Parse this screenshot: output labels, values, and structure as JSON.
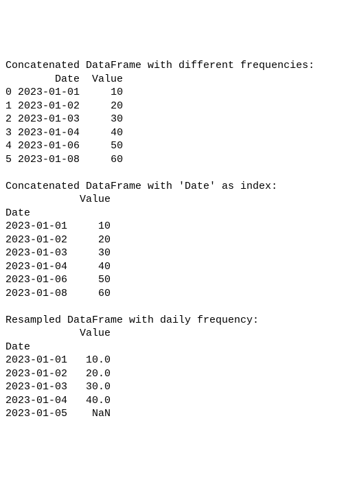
{
  "section1": {
    "title": "Concatenated DataFrame with different frequencies:",
    "header": "        Date  Value",
    "rows": [
      {
        "idx": "0",
        "date": "2023-01-01",
        "value": "10"
      },
      {
        "idx": "1",
        "date": "2023-01-02",
        "value": "20"
      },
      {
        "idx": "2",
        "date": "2023-01-03",
        "value": "30"
      },
      {
        "idx": "3",
        "date": "2023-01-04",
        "value": "40"
      },
      {
        "idx": "4",
        "date": "2023-01-06",
        "value": "50"
      },
      {
        "idx": "5",
        "date": "2023-01-08",
        "value": "60"
      }
    ]
  },
  "section2": {
    "title": "Concatenated DataFrame with 'Date' as index:",
    "header": "            Value",
    "index_label": "Date",
    "rows": [
      {
        "date": "2023-01-01",
        "value": "10"
      },
      {
        "date": "2023-01-02",
        "value": "20"
      },
      {
        "date": "2023-01-03",
        "value": "30"
      },
      {
        "date": "2023-01-04",
        "value": "40"
      },
      {
        "date": "2023-01-06",
        "value": "50"
      },
      {
        "date": "2023-01-08",
        "value": "60"
      }
    ]
  },
  "section3": {
    "title": "Resampled DataFrame with daily frequency:",
    "header": "            Value",
    "index_label": "Date",
    "rows": [
      {
        "date": "2023-01-01",
        "value": "10.0"
      },
      {
        "date": "2023-01-02",
        "value": "20.0"
      },
      {
        "date": "2023-01-03",
        "value": "30.0"
      },
      {
        "date": "2023-01-04",
        "value": "40.0"
      },
      {
        "date": "2023-01-05",
        "value": "NaN"
      }
    ]
  }
}
